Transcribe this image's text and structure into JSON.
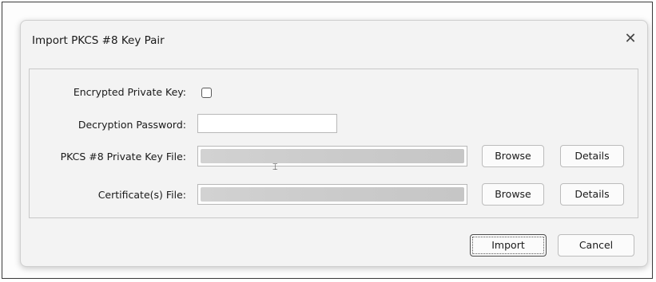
{
  "dialog": {
    "title": "Import PKCS #8 Key Pair",
    "close_glyph": "✕"
  },
  "form": {
    "encrypted_label": "Encrypted Private Key:",
    "encrypted_checked": false,
    "password_label": "Decryption Password:",
    "password_value": "",
    "private_key_label": "PKCS #8 Private Key File:",
    "certificate_label": "Certificate(s) File:"
  },
  "buttons": {
    "browse_key": "Browse",
    "details_key": "Details",
    "browse_cert": "Browse",
    "details_cert": "Details",
    "import": "Import",
    "cancel": "Cancel"
  }
}
